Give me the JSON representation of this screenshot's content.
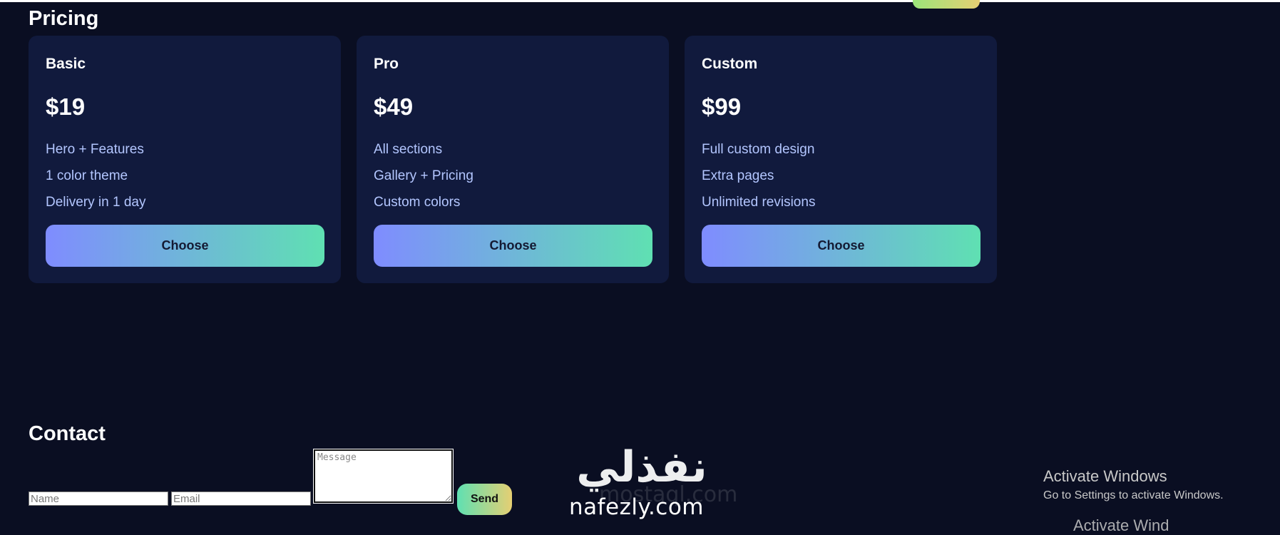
{
  "pricing": {
    "title": "Pricing",
    "plans": [
      {
        "name": "Basic",
        "price": "$19",
        "features": [
          "Hero + Features",
          "1 color theme",
          "Delivery in 1 day"
        ],
        "button": "Choose"
      },
      {
        "name": "Pro",
        "price": "$49",
        "features": [
          "All sections",
          "Gallery + Pricing",
          "Custom colors"
        ],
        "button": "Choose"
      },
      {
        "name": "Custom",
        "price": "$99",
        "features": [
          "Full custom design",
          "Extra pages",
          "Unlimited revisions"
        ],
        "button": "Choose"
      }
    ]
  },
  "contact": {
    "title": "Contact",
    "name_placeholder": "Name",
    "email_placeholder": "Email",
    "message_placeholder": "Message",
    "send_label": "Send"
  },
  "watermark": {
    "arabic": "نفذلي",
    "latin": "nafezly.com",
    "ghost": "mostaql.com"
  },
  "system_overlay": {
    "title": "Activate Windows",
    "subtitle": "Go to Settings to activate Windows.",
    "ghost": "Activate Wind"
  },
  "colors": {
    "page_background": "#0a0e22",
    "card_background": "#111a3d",
    "feature_text": "#b3c6ff",
    "button_gradient_start": "#7f8cff",
    "button_gradient_end": "#5fe0b2",
    "send_gradient_end": "#e6cf73"
  }
}
